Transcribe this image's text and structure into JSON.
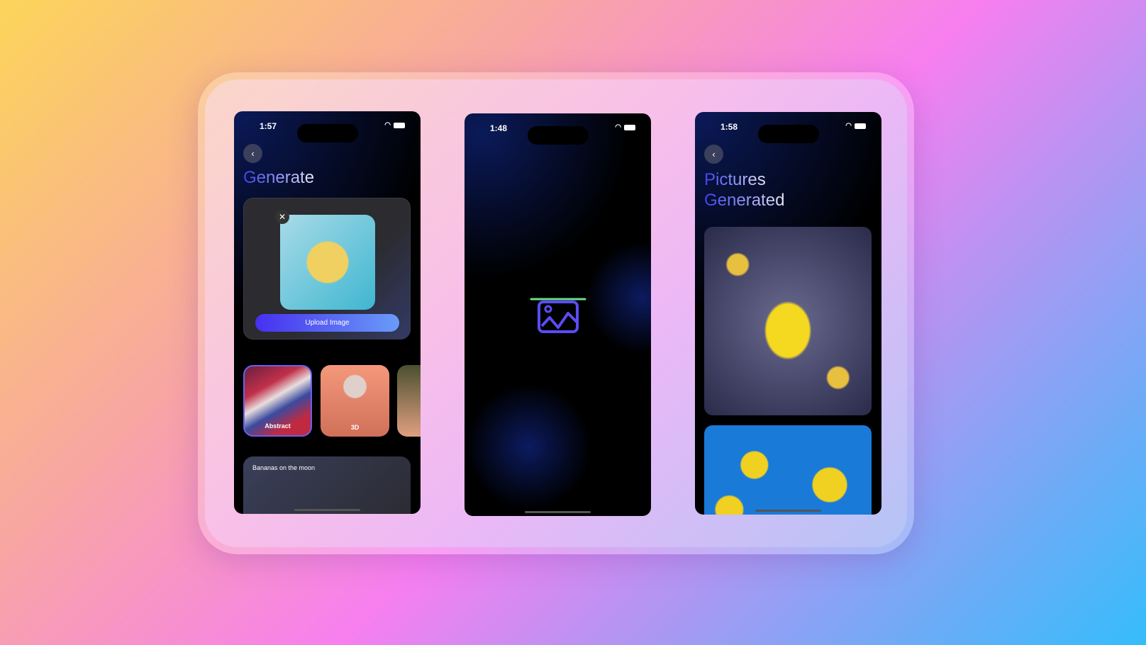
{
  "screens": [
    {
      "time": "1:57",
      "title": "Generate",
      "upload_label": "Upload Image",
      "styles": [
        "Abstract",
        "3D",
        ""
      ],
      "prompt": "Bananas on the moon"
    },
    {
      "time": "1:48",
      "icon": "image-icon",
      "accent": "#5a4cf4",
      "loader": "#6fdc8c"
    },
    {
      "time": "1:58",
      "title_line1": "Pictures",
      "title_line2": "Generated"
    }
  ]
}
